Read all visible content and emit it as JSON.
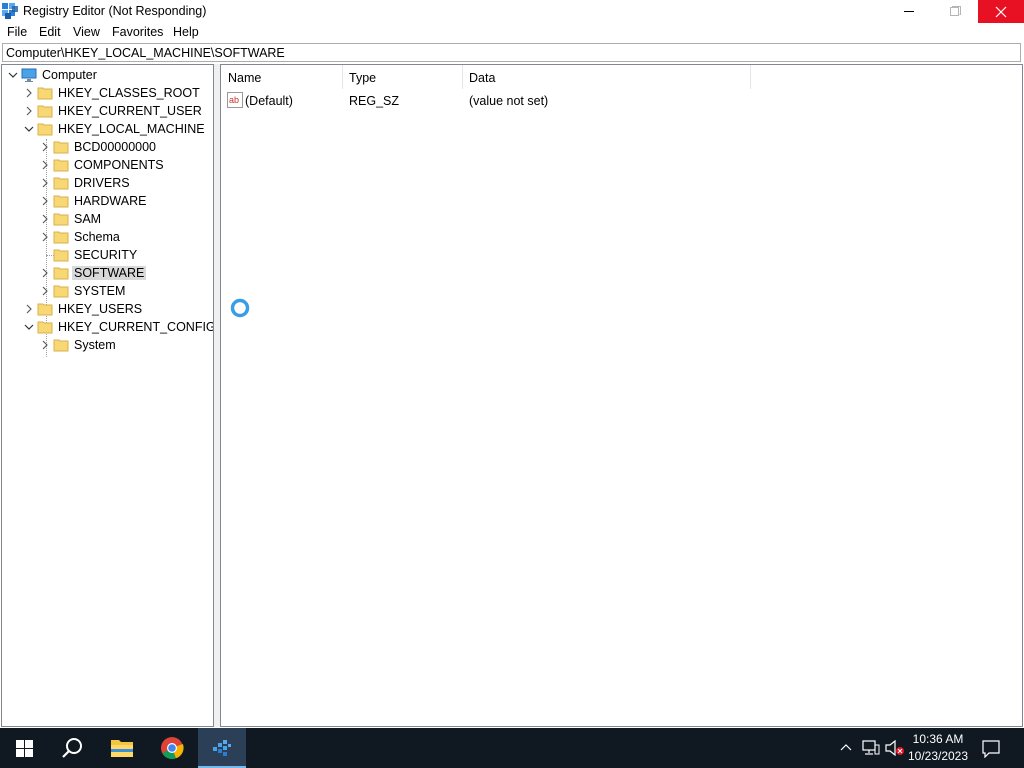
{
  "window": {
    "title": "Registry Editor (Not Responding)",
    "accent_close": "#e81123"
  },
  "menu": {
    "items": [
      "File",
      "Edit",
      "View",
      "Favorites",
      "Help"
    ]
  },
  "address": {
    "path": "Computer\\HKEY_LOCAL_MACHINE\\SOFTWARE"
  },
  "tree": {
    "root": "Computer",
    "hives": {
      "classes_root": "HKEY_CLASSES_ROOT",
      "current_user": "HKEY_CURRENT_USER",
      "local_machine": "HKEY_LOCAL_MACHINE",
      "users": "HKEY_USERS",
      "current_config": "HKEY_CURRENT_CONFIG"
    },
    "local_machine_children": [
      "BCD00000000",
      "COMPONENTS",
      "DRIVERS",
      "HARDWARE",
      "SAM",
      "Schema",
      "SECURITY",
      "SOFTWARE",
      "SYSTEM"
    ],
    "current_config_children": [
      "System"
    ],
    "selected": "SOFTWARE"
  },
  "values": {
    "columns": {
      "name": "Name",
      "type": "Type",
      "data": "Data"
    },
    "rows": [
      {
        "name": "(Default)",
        "type": "REG_SZ",
        "data": "(value not set)",
        "icon": "string-value-icon"
      }
    ]
  },
  "taskbar": {
    "apps": [
      "start-icon",
      "search-icon",
      "file-explorer-icon",
      "chrome-icon",
      "regedit-icon"
    ],
    "active_app": "regedit-icon",
    "tray": [
      "show-hidden-icons-icon",
      "network-icon",
      "volume-muted-icon"
    ],
    "time": "10:36 AM",
    "date": "10/23/2023"
  },
  "colors": {
    "taskbar": "#101822",
    "selection": "#d9d9d9",
    "folder": "#f8d775",
    "busy": "#3a9ee4"
  }
}
